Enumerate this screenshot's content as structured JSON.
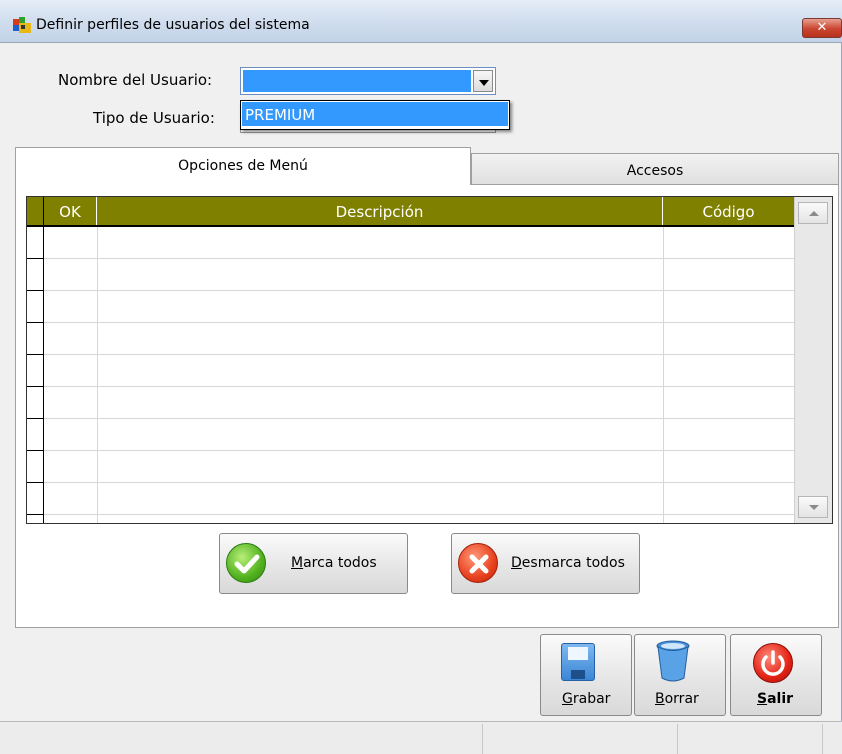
{
  "window": {
    "title": "Definir perfiles de usuarios del sistema",
    "close_icon": "close-icon",
    "close_glyph": "✕"
  },
  "form": {
    "user_label": "Nombre del Usuario:",
    "user_value": "",
    "type_label": "Tipo de Usuario:",
    "type_value": "",
    "dropdown_options": [
      "PREMIUM"
    ]
  },
  "tabs": [
    {
      "label": "Opciones de Menú",
      "active": true
    },
    {
      "label": "Accesos",
      "active": false
    }
  ],
  "grid": {
    "columns": [
      "OK",
      "Descripción",
      "Código"
    ],
    "rows": [],
    "header_color": "#808000"
  },
  "buttons": {
    "mark_all": {
      "prefix": "",
      "underlined": "M",
      "rest": "arca todos",
      "icon": "check-icon"
    },
    "unmark_all": {
      "prefix": "",
      "underlined": "D",
      "rest": "esmarca todos",
      "icon": "x-icon"
    },
    "save": {
      "underlined": "G",
      "rest": "rabar",
      "icon": "floppy-disk-icon"
    },
    "delete": {
      "underlined": "B",
      "rest": "orrar",
      "icon": "trash-icon"
    },
    "exit": {
      "underlined": "S",
      "rest": "alir",
      "icon": "power-icon"
    }
  },
  "colors": {
    "selection": "#3399ff",
    "grid_header": "#808000"
  }
}
